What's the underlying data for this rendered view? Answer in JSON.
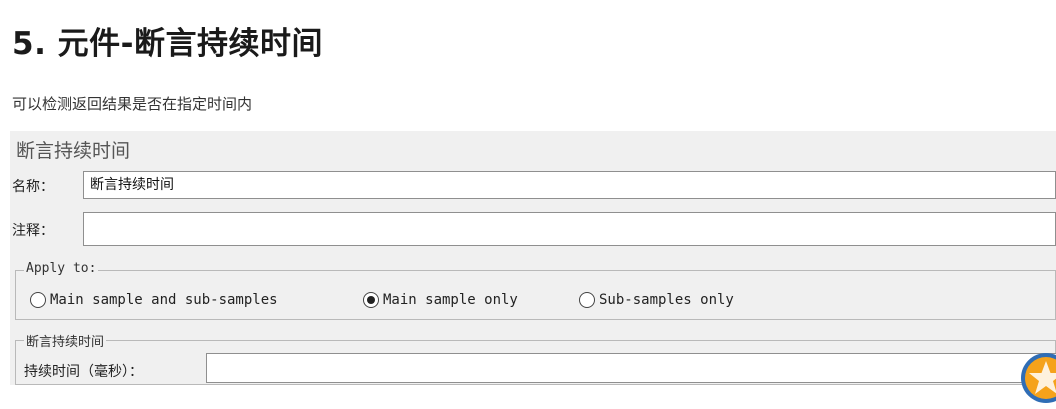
{
  "slide": {
    "title": "5. 元件-断言持续时间",
    "description": "可以检测返回结果是否在指定时间内"
  },
  "panel": {
    "title": "断言持续时间",
    "name_label": "名称：",
    "name_value": "断言持续时间",
    "comment_label": "注释：",
    "comment_value": "",
    "apply_to": {
      "legend": "Apply to:",
      "options": [
        {
          "label": "Main sample and sub-samples",
          "checked": false
        },
        {
          "label": "Main sample only",
          "checked": true
        },
        {
          "label": "Sub-samples only",
          "checked": false
        }
      ]
    },
    "duration_group": {
      "legend": "断言持续时间",
      "label": "持续时间（毫秒）：",
      "value": ""
    }
  },
  "colors": {
    "panel_bg": "#f0f0f0",
    "field_border": "#8f8f8f",
    "logo_blue": "#2f6db5",
    "logo_orange": "#f5a21b"
  },
  "icons": {
    "corner_logo": "star-logo-icon"
  }
}
